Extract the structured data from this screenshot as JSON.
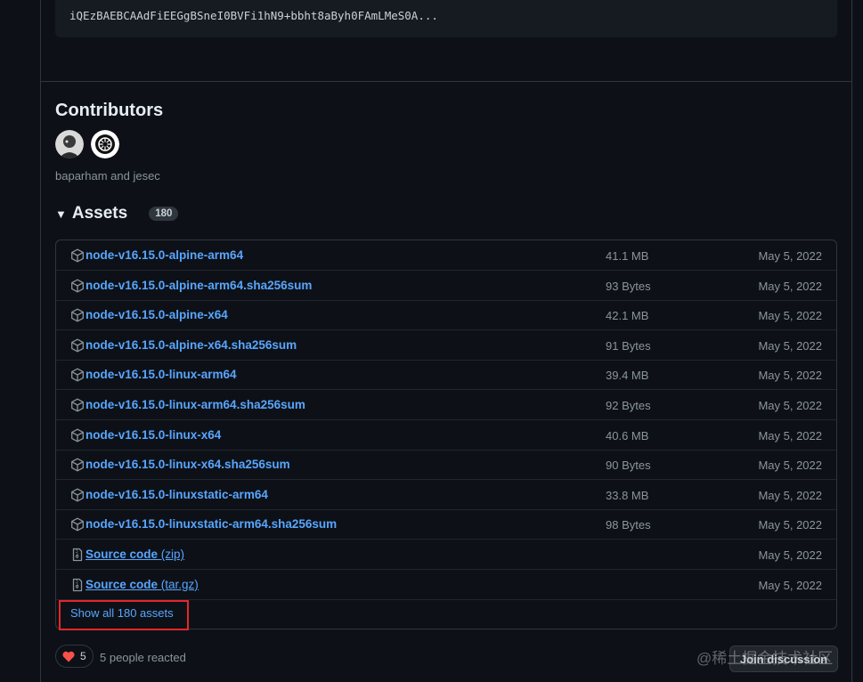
{
  "signature": {
    "text": "iQEzBAEBCAAdFiEEGgBSneI0BVFi1hN9+bbht8aByh0FAmLMeS0A..."
  },
  "contributors": {
    "title": "Contributors",
    "names": "baparham and jesec"
  },
  "assets": {
    "title": "Assets",
    "count": "180",
    "rows": [
      {
        "name": "node-v16.15.0-alpine-arm64",
        "size": "41.1 MB",
        "date": "May 5, 2022"
      },
      {
        "name": "node-v16.15.0-alpine-arm64.sha256sum",
        "size": "93 Bytes",
        "date": "May 5, 2022"
      },
      {
        "name": "node-v16.15.0-alpine-x64",
        "size": "42.1 MB",
        "date": "May 5, 2022"
      },
      {
        "name": "node-v16.15.0-alpine-x64.sha256sum",
        "size": "91 Bytes",
        "date": "May 5, 2022"
      },
      {
        "name": "node-v16.15.0-linux-arm64",
        "size": "39.4 MB",
        "date": "May 5, 2022"
      },
      {
        "name": "node-v16.15.0-linux-arm64.sha256sum",
        "size": "92 Bytes",
        "date": "May 5, 2022"
      },
      {
        "name": "node-v16.15.0-linux-x64",
        "size": "40.6 MB",
        "date": "May 5, 2022"
      },
      {
        "name": "node-v16.15.0-linux-x64.sha256sum",
        "size": "90 Bytes",
        "date": "May 5, 2022"
      },
      {
        "name": "node-v16.15.0-linuxstatic-arm64",
        "size": "33.8 MB",
        "date": "May 5, 2022"
      },
      {
        "name": "node-v16.15.0-linuxstatic-arm64.sha256sum",
        "size": "98 Bytes",
        "date": "May 5, 2022"
      }
    ],
    "source_rows": [
      {
        "name": "Source code",
        "format": "(zip)",
        "date": "May 5, 2022"
      },
      {
        "name": "Source code",
        "format": "(tar.gz)",
        "date": "May 5, 2022"
      }
    ],
    "show_all": "Show all 180 assets"
  },
  "reactions": {
    "heart_count": "5",
    "summary": "5 people reacted"
  },
  "join_discussion": "Join discussion",
  "watermark": "@稀土掘金技术社区",
  "icons": {
    "package": "package-icon",
    "file_zip": "file-zip-icon",
    "heart": "heart-icon"
  },
  "colors": {
    "background": "#0d1117",
    "link": "#58a6ff",
    "muted": "#8b949e",
    "highlight": "#e5262a",
    "heart": "#f85149"
  }
}
